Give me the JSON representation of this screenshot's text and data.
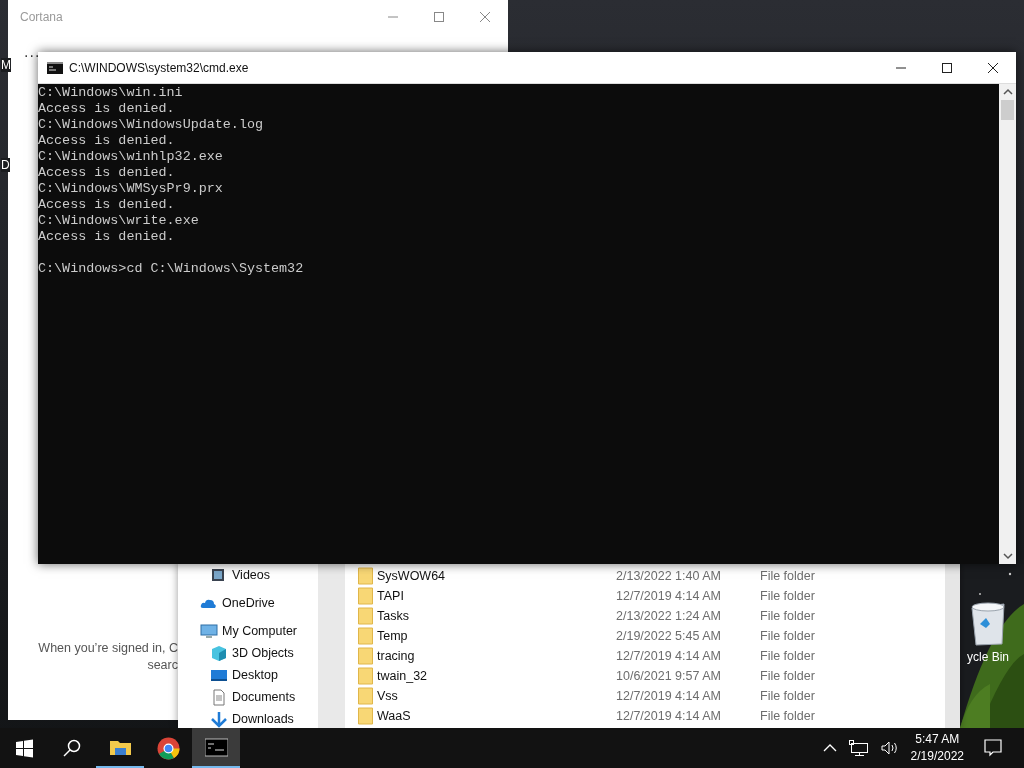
{
  "desktop": {
    "edge_labels": [
      "M",
      "D"
    ],
    "recycle_bin": {
      "label": "ycle Bin"
    }
  },
  "cortana": {
    "title": "Cortana",
    "more": "...",
    "message_lines": [
      "When you’re signed in, C",
      "searc"
    ]
  },
  "explorer": {
    "nav_partial_children": [
      {
        "label": "Videos",
        "kind": "videos"
      }
    ],
    "nav": [
      {
        "label": "OneDrive",
        "kind": "cloud"
      },
      {
        "label": "My Computer",
        "kind": "computer",
        "children": [
          {
            "label": "3D Objects",
            "kind": "cube"
          },
          {
            "label": "Desktop",
            "kind": "desktop"
          },
          {
            "label": "Documents",
            "kind": "document"
          },
          {
            "label": "Downloads",
            "kind": "download"
          }
        ]
      }
    ],
    "files": [
      {
        "name": "SysWOW64",
        "modified": "2/13/2022 1:40 AM",
        "type": "File folder"
      },
      {
        "name": "TAPI",
        "modified": "12/7/2019 4:14 AM",
        "type": "File folder"
      },
      {
        "name": "Tasks",
        "modified": "2/13/2022 1:24 AM",
        "type": "File folder"
      },
      {
        "name": "Temp",
        "modified": "2/19/2022 5:45 AM",
        "type": "File folder"
      },
      {
        "name": "tracing",
        "modified": "12/7/2019 4:14 AM",
        "type": "File folder"
      },
      {
        "name": "twain_32",
        "modified": "10/6/2021 9:57 AM",
        "type": "File folder"
      },
      {
        "name": "Vss",
        "modified": "12/7/2019 4:14 AM",
        "type": "File folder"
      },
      {
        "name": "WaaS",
        "modified": "12/7/2019 4:14 AM",
        "type": "File folder"
      }
    ]
  },
  "cmd": {
    "title": "C:\\WINDOWS\\system32\\cmd.exe",
    "output": [
      "C:\\Windows\\win.ini",
      "Access is denied.",
      "C:\\Windows\\WindowsUpdate.log",
      "Access is denied.",
      "C:\\Windows\\winhlp32.exe",
      "Access is denied.",
      "C:\\Windows\\WMSysPr9.prx",
      "Access is denied.",
      "C:\\Windows\\write.exe",
      "Access is denied."
    ],
    "prompt": "C:\\Windows>cd C:\\Windows\\System32"
  },
  "taskbar": {
    "apps": [
      {
        "kind": "start",
        "running": false,
        "selected": false
      },
      {
        "kind": "search",
        "running": false,
        "selected": false
      },
      {
        "kind": "explorer",
        "running": true,
        "selected": false
      },
      {
        "kind": "chrome",
        "running": false,
        "selected": false
      },
      {
        "kind": "cmd",
        "running": true,
        "selected": true
      }
    ],
    "clock": {
      "time": "5:47 AM",
      "date": "2/19/2022"
    }
  }
}
